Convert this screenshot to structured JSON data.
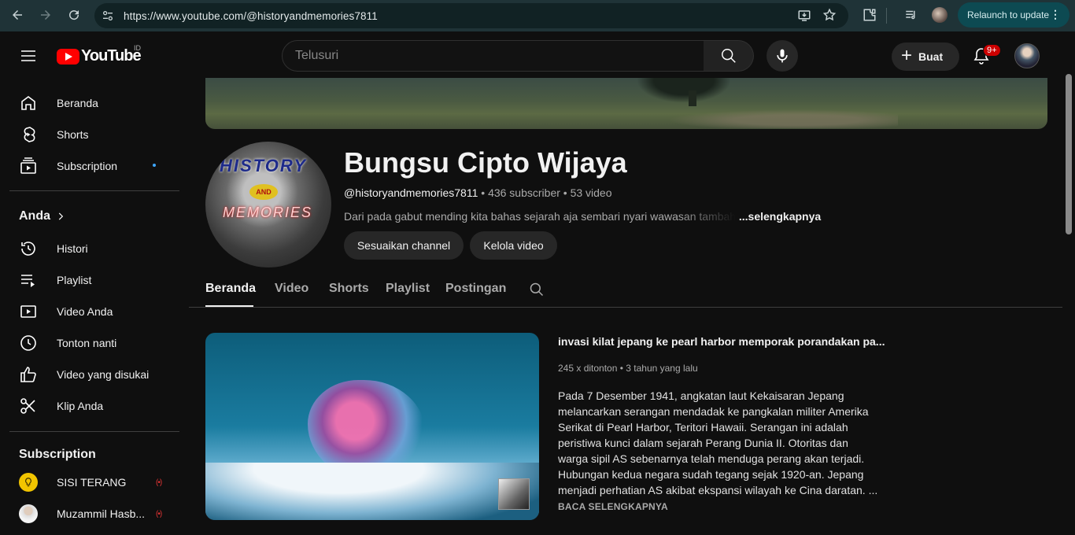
{
  "browser": {
    "url": "https://www.youtube.com/@historyandmemories7811",
    "relaunch_label": "Relaunch to update"
  },
  "header": {
    "logo_text": "YouTube",
    "country_code": "ID",
    "search_placeholder": "Telusuri",
    "create_label": "Buat",
    "notification_count": "9+"
  },
  "sidebar": {
    "main": [
      {
        "label": "Beranda",
        "icon": "home-icon"
      },
      {
        "label": "Shorts",
        "icon": "shorts-icon"
      },
      {
        "label": "Subscription",
        "icon": "subscriptions-icon"
      }
    ],
    "you_heading": "Anda",
    "you": [
      {
        "label": "Histori",
        "icon": "history-icon"
      },
      {
        "label": "Playlist",
        "icon": "playlist-icon"
      },
      {
        "label": "Video Anda",
        "icon": "your-videos-icon"
      },
      {
        "label": "Tonton nanti",
        "icon": "watch-later-icon"
      },
      {
        "label": "Video yang disukai",
        "icon": "liked-icon"
      },
      {
        "label": "Klip Anda",
        "icon": "clips-icon"
      }
    ],
    "subs_heading": "Subscription",
    "subs": [
      {
        "label": "SISI TERANG"
      },
      {
        "label": "Muzammil Hasb..."
      }
    ]
  },
  "channel": {
    "name": "Bungsu Cipto Wijaya",
    "handle": "@historyandmemories7811",
    "subscribers": "436 subscriber",
    "videos": "53 video",
    "description": "Dari pada gabut mending kita bahas sejarah aja sembari nyari wawasan tambahan",
    "more_label": "...selengkapnya",
    "customize_label": "Sesuaikan channel",
    "manage_label": "Kelola video",
    "avatar_text": {
      "top": "HISTORY",
      "middle": "AND",
      "bottom": "MEMORIES"
    }
  },
  "tabs": [
    "Beranda",
    "Video",
    "Shorts",
    "Playlist",
    "Postingan"
  ],
  "featured": {
    "title": "invasi kilat jepang ke pearl harbor memporak porandakan pa...",
    "meta": "245 x ditonton • 3 tahun yang lalu",
    "description": "Pada 7 Desember 1941,  angkatan laut Kekaisaran Jepang melancarkan serangan mendadak ke pangkalan militer Amerika Serikat di Pearl Harbor, Teritori Hawaii. Serangan ini adalah peristiwa kunci dalam sejarah Perang Dunia II. Otoritas dan warga sipil AS sebenarnya telah menduga perang akan terjadi. Hubungan kedua negara sudah tegang sejak 1920-an. Jepang menjadi perhatian AS akibat ekspansi wilayah ke Cina daratan. ...",
    "read_more": "BACA SELENGKAPNYA"
  }
}
